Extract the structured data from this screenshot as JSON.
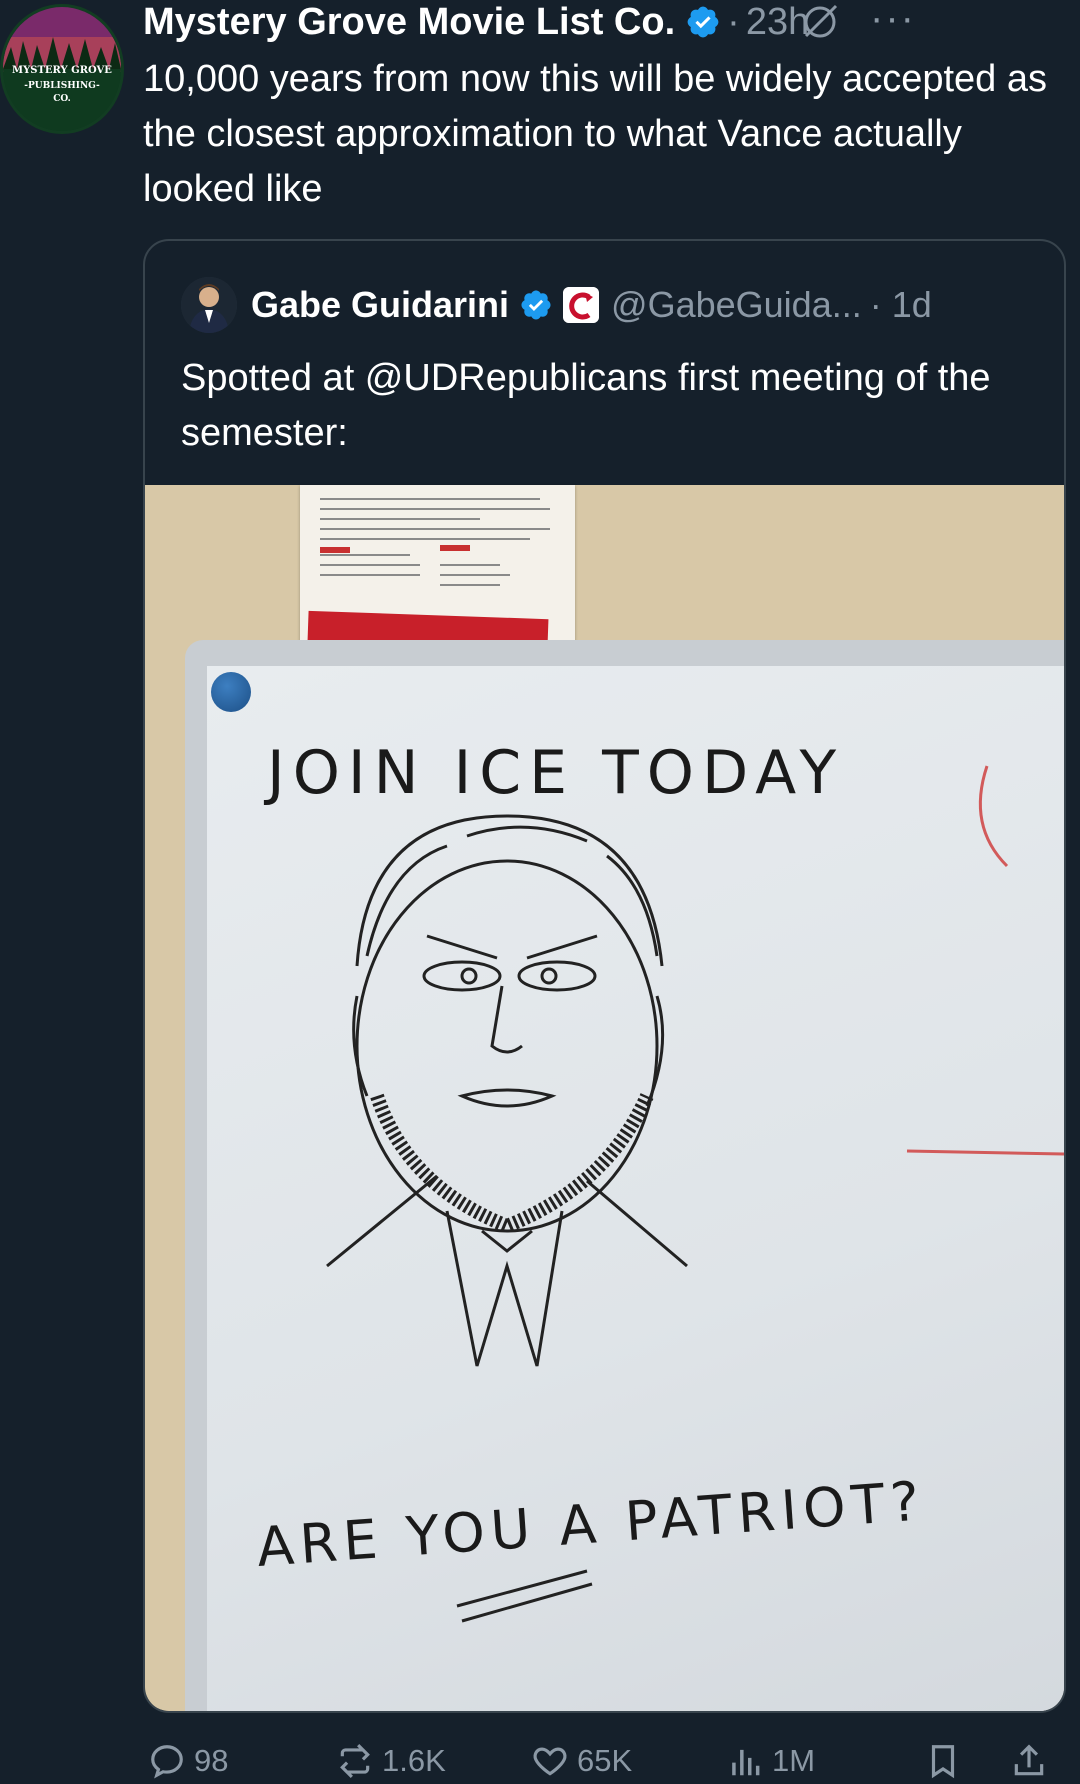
{
  "tweet": {
    "author_name": "Mystery Grove Movie List Co.",
    "avatar_line1": "MYSTERY GROVE",
    "avatar_line2": "-PUBLISHING-",
    "avatar_line3": "CO.",
    "time": "23h",
    "separator": "·",
    "more": "···",
    "text": "10,000 years from now this will be widely accepted as the closest approximation to what Vance actually looked like"
  },
  "quote": {
    "author_name": "Gabe Guidarini",
    "handle": "@GabeGuida...",
    "time": "· 1d",
    "text": "Spotted at @UDRepublicans first meeting of the semester:",
    "photo": {
      "board_line1": "JOIN ICE TODAY",
      "board_line2": "ARE YOU A PATRIOT?"
    }
  },
  "actions": {
    "replies": "98",
    "reposts": "1.6K",
    "likes": "65K",
    "views": "1M"
  },
  "colors": {
    "background": "#15202b",
    "secondary_text": "#8b98a5",
    "border": "#38444d",
    "verified": "#1d9bf0"
  },
  "icons": [
    "grok-icon",
    "more-icon",
    "verified-icon",
    "reply-icon",
    "repost-icon",
    "like-icon",
    "views-icon",
    "bookmark-icon",
    "share-icon"
  ]
}
